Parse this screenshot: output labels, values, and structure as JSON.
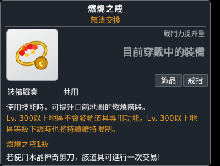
{
  "item": {
    "name": "燃燒之戒",
    "trade_status": "無法交換",
    "icon": "ring-icon"
  },
  "stats": {
    "header": "戰鬥力提升量",
    "equipped_compare": "目前穿戴中的裝備"
  },
  "requirements": {
    "job_label": "裝備職業",
    "job_value": "共用"
  },
  "tags": [
    "飾品",
    "戒指"
  ],
  "description": {
    "line1": "使用技能時，可提升目前地圖的燃燒階段。",
    "line2": "Lv. 300以上地區不會發動道具專用功能，Lv. 300以上地",
    "line3": "區等級下調時也將持續維持限制。"
  },
  "set_name": "燃燒之戒1級",
  "footer": "若使用水晶神奇剪刀，該道具可進行一次交易!",
  "colors": {
    "background": "#1f252c",
    "accent": "#f0a020",
    "border": "#6a6e74"
  }
}
